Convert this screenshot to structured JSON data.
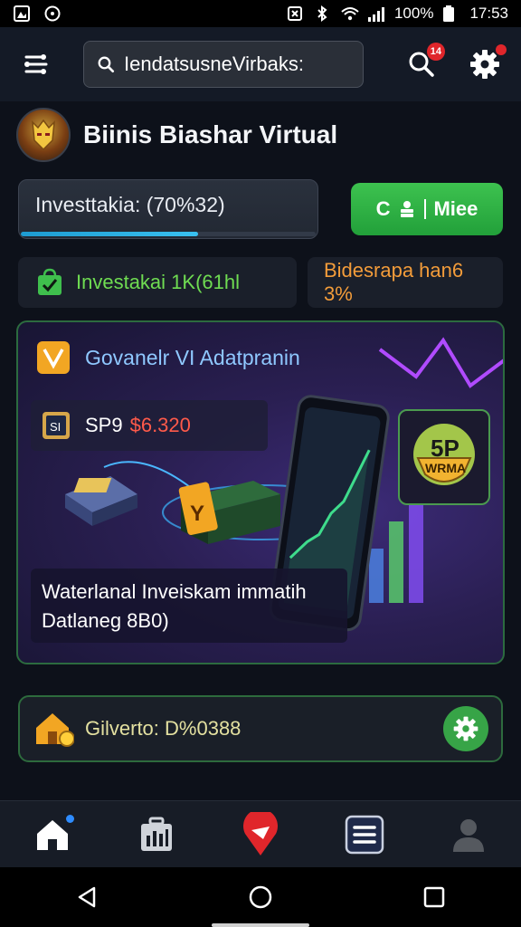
{
  "status_bar": {
    "battery": "100%",
    "time": "17:53"
  },
  "header": {
    "search_value": "IendatsusneVirbaks:",
    "notification_count": "14"
  },
  "profile": {
    "name": "Biinis Biashar Virtual"
  },
  "investment": {
    "label": "Investtakia: (70%32)",
    "progress": 0.6
  },
  "cta": {
    "label": "Miee"
  },
  "stats": {
    "green_label": "Investakai 1K(61hl",
    "orange_label": "Bidesrapa han6 3%"
  },
  "feature": {
    "title": "Govanelr VI Adatpranin",
    "ticker": "SP9",
    "price": "$6.320",
    "caption_line1": "Waterlanal Inveiskam immatih",
    "caption_line2": "Datlaneg 8B0)",
    "badge_top": "5P",
    "badge_bottom": "WRMA"
  },
  "balance": {
    "label": "Gilverto: D%0388"
  },
  "colors": {
    "accent_green": "#2fb345",
    "accent_orange": "#f39c3a",
    "accent_blue": "#39c0f0",
    "price_red": "#ff5a4a"
  }
}
